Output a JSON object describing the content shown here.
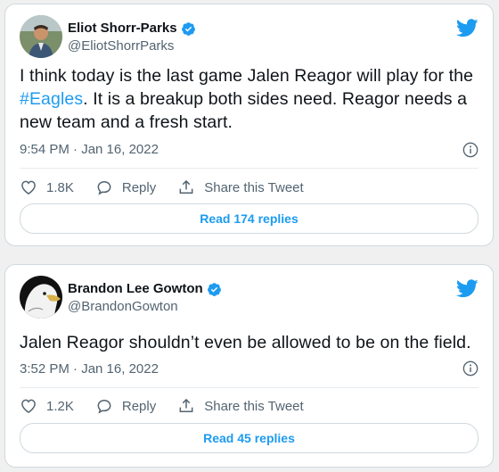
{
  "colors": {
    "accent": "#1d9bf0",
    "muted": "#536471",
    "text": "#0f1419"
  },
  "tweets": [
    {
      "display_name": "Eliot Shorr-Parks",
      "handle": "@EliotShorrParks",
      "text_before": "I think today is the last game Jalen Reagor will play for the ",
      "hashtag": "#Eagles",
      "text_after": ". It is a breakup both sides need. Reagor needs a new team and a fresh start.",
      "timestamp": "9:54 PM · Jan 16, 2022",
      "likes": "1.8K",
      "reply_label": "Reply",
      "share_label": "Share this Tweet",
      "replies_button": "Read 174 replies"
    },
    {
      "display_name": "Brandon Lee Gowton",
      "handle": "@BrandonGowton",
      "text": "Jalen Reagor shouldn’t even be allowed to be on the field.",
      "timestamp": "3:52 PM · Jan 16, 2022",
      "likes": "1.2K",
      "reply_label": "Reply",
      "share_label": "Share this Tweet",
      "replies_button": "Read 45 replies"
    }
  ]
}
